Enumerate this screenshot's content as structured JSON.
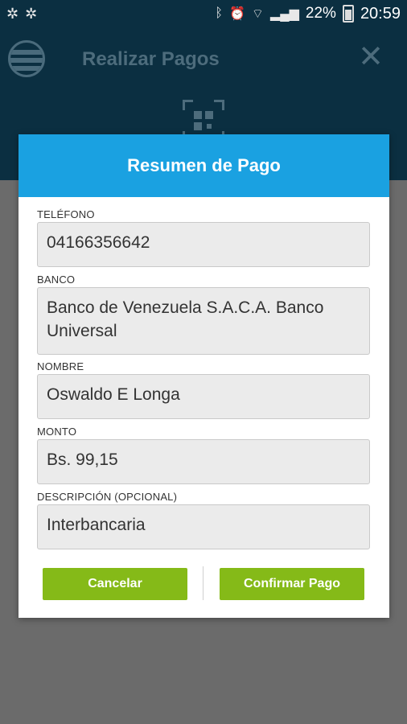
{
  "status_bar": {
    "left_icons": [
      "app-notification-icon",
      "app-notification-icon"
    ],
    "icons": [
      "bluetooth-icon",
      "alarm-icon",
      "wifi-icon",
      "signal-icon"
    ],
    "battery": "22%",
    "time": "20:59"
  },
  "app_header": {
    "title": "Realizar Pagos"
  },
  "dialog": {
    "title": "Resumen de Pago",
    "fields": [
      {
        "label": "TELÉFONO",
        "value": "04166356642"
      },
      {
        "label": "BANCO",
        "value": "Banco de Venezuela S.A.C.A. Banco Universal"
      },
      {
        "label": "NOMBRE",
        "value": "Oswaldo E Longa"
      },
      {
        "label": "MONTO",
        "value": "Bs. 99,15"
      },
      {
        "label": "DESCRIPCIÓN (OPCIONAL)",
        "value": "Interbancaria"
      }
    ],
    "cancel_label": "Cancelar",
    "confirm_label": "Confirmar Pago"
  },
  "colors": {
    "header_dark": "#0b2f41",
    "dialog_header": "#1aa1e1",
    "button_green": "#85ba18",
    "overlay_gray": "#6b6b6b"
  }
}
